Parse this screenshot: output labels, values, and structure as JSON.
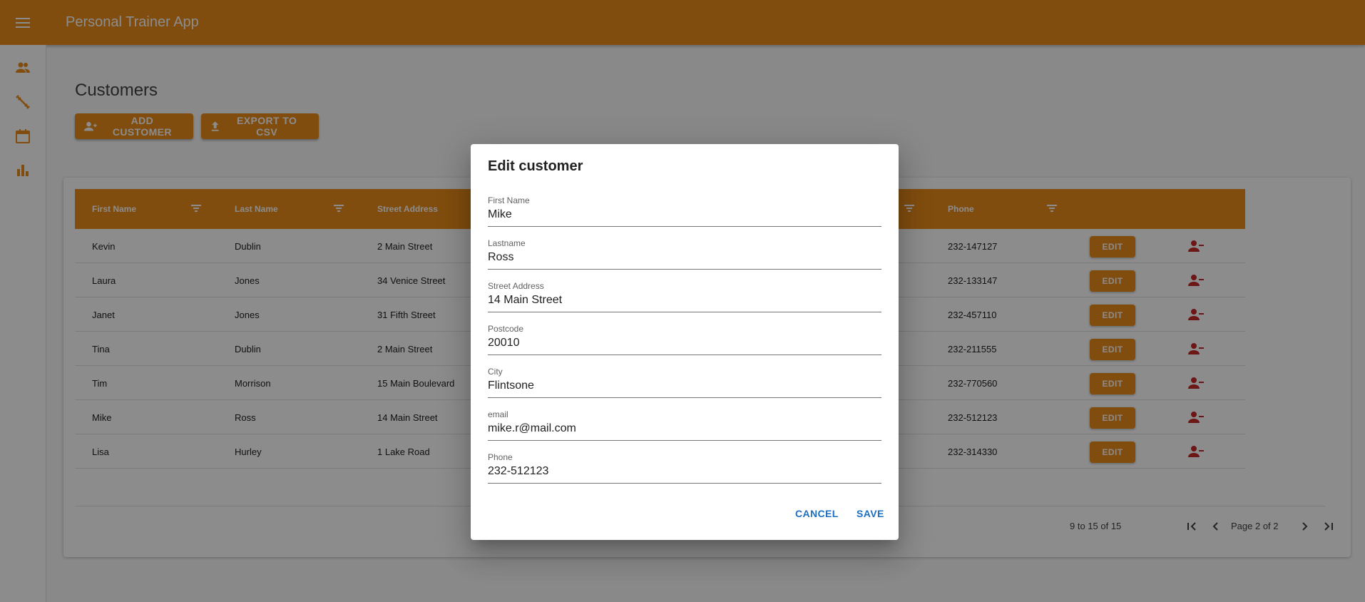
{
  "app": {
    "title": "Personal Trainer App",
    "accent_color": "#e98c1b",
    "menu_icon": "menu-icon"
  },
  "sidenav": {
    "items": [
      {
        "name": "customers",
        "icon": "people-icon"
      },
      {
        "name": "trainings",
        "icon": "fitness-icon"
      },
      {
        "name": "calendar",
        "icon": "calendar-icon"
      },
      {
        "name": "statistics",
        "icon": "bar-chart-icon"
      }
    ]
  },
  "page": {
    "title": "Customers",
    "add_label": "ADD CUSTOMER",
    "export_label": "EXPORT TO CSV"
  },
  "grid": {
    "columns": [
      "First Name",
      "Last Name",
      "Street Address",
      "Phone"
    ],
    "edit_label": "EDIT",
    "rows": [
      {
        "first": "Kevin",
        "last": "Dublin",
        "street": "2 Main Street",
        "phone": "232-147127"
      },
      {
        "first": "Laura",
        "last": "Jones",
        "street": "34 Venice Street",
        "phone": "232-133147"
      },
      {
        "first": "Janet",
        "last": "Jones",
        "street": "31 Fifth Street",
        "phone": "232-457110"
      },
      {
        "first": "Tina",
        "last": "Dublin",
        "street": "2 Main Street",
        "phone": "232-211555"
      },
      {
        "first": "Tim",
        "last": "Morrison",
        "street": "15 Main Boulevard",
        "phone": "232-770560"
      },
      {
        "first": "Mike",
        "last": "Ross",
        "street": "14 Main Street",
        "phone": "232-512123"
      },
      {
        "first": "Lisa",
        "last": "Hurley",
        "street": "1 Lake Road",
        "phone": "232-314330"
      }
    ],
    "pager": {
      "summary": "9 to 15 of 15",
      "page_text": "Page 2 of 2"
    }
  },
  "dialog": {
    "title": "Edit customer",
    "fields": [
      {
        "label": "First Name",
        "value": "Mike"
      },
      {
        "label": "Lastname",
        "value": "Ross"
      },
      {
        "label": "Street Address",
        "value": "14 Main Street"
      },
      {
        "label": "Postcode",
        "value": "20010"
      },
      {
        "label": "City",
        "value": "Flintsone"
      },
      {
        "label": "email",
        "value": "mike.r@mail.com"
      },
      {
        "label": "Phone",
        "value": "232-512123"
      }
    ],
    "cancel_label": "CANCEL",
    "save_label": "SAVE"
  }
}
